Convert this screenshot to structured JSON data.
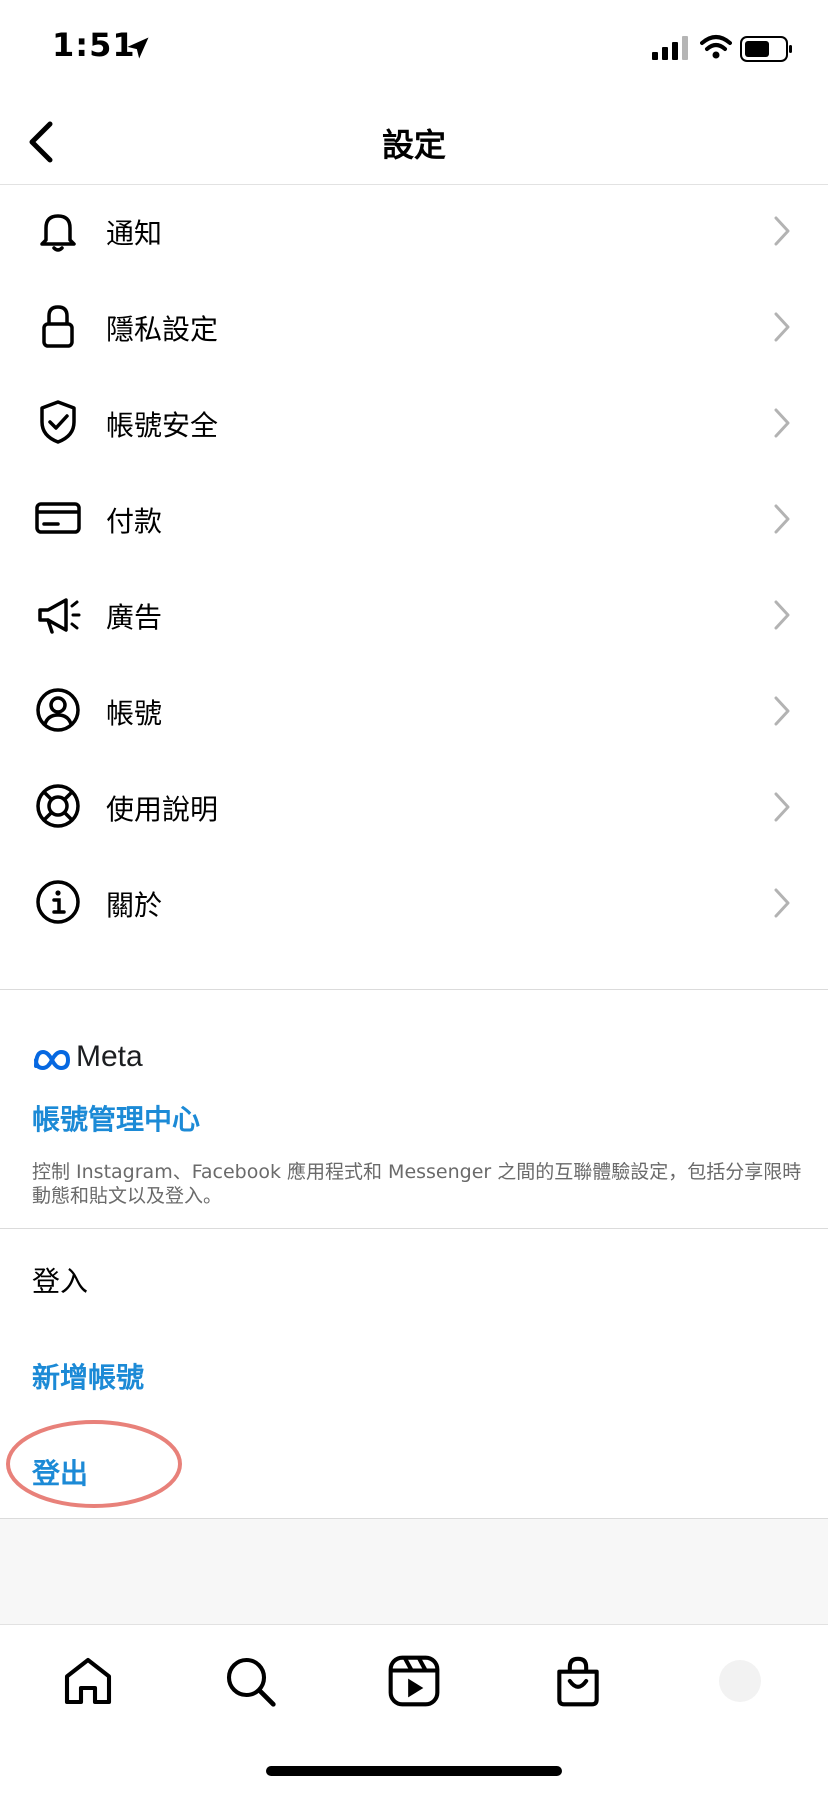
{
  "status_bar": {
    "time": "1:51"
  },
  "nav": {
    "title": "設定"
  },
  "settings_items": [
    {
      "label": "通知",
      "icon": "bell-icon"
    },
    {
      "label": "隱私設定",
      "icon": "lock-icon"
    },
    {
      "label": "帳號安全",
      "icon": "shield-check-icon"
    },
    {
      "label": "付款",
      "icon": "credit-card-icon"
    },
    {
      "label": "廣告",
      "icon": "megaphone-icon"
    },
    {
      "label": "帳號",
      "icon": "user-circle-icon"
    },
    {
      "label": "使用說明",
      "icon": "lifebuoy-icon"
    },
    {
      "label": "關於",
      "icon": "info-icon"
    }
  ],
  "meta": {
    "brand": "Meta",
    "accounts_center": "帳號管理中心",
    "description": "控制 Instagram、Facebook 應用程式和 Messenger 之間的互聯體驗設定，包括分享限時動態和貼文以及登入。"
  },
  "login": {
    "heading": "登入",
    "add_account": "新增帳號",
    "logout": "登出"
  },
  "tabs": [
    "home-icon",
    "search-icon",
    "reels-icon",
    "shop-icon",
    "profile-icon"
  ],
  "colors": {
    "link": "#1c8ad6",
    "highlight_ring": "#e8817a"
  }
}
